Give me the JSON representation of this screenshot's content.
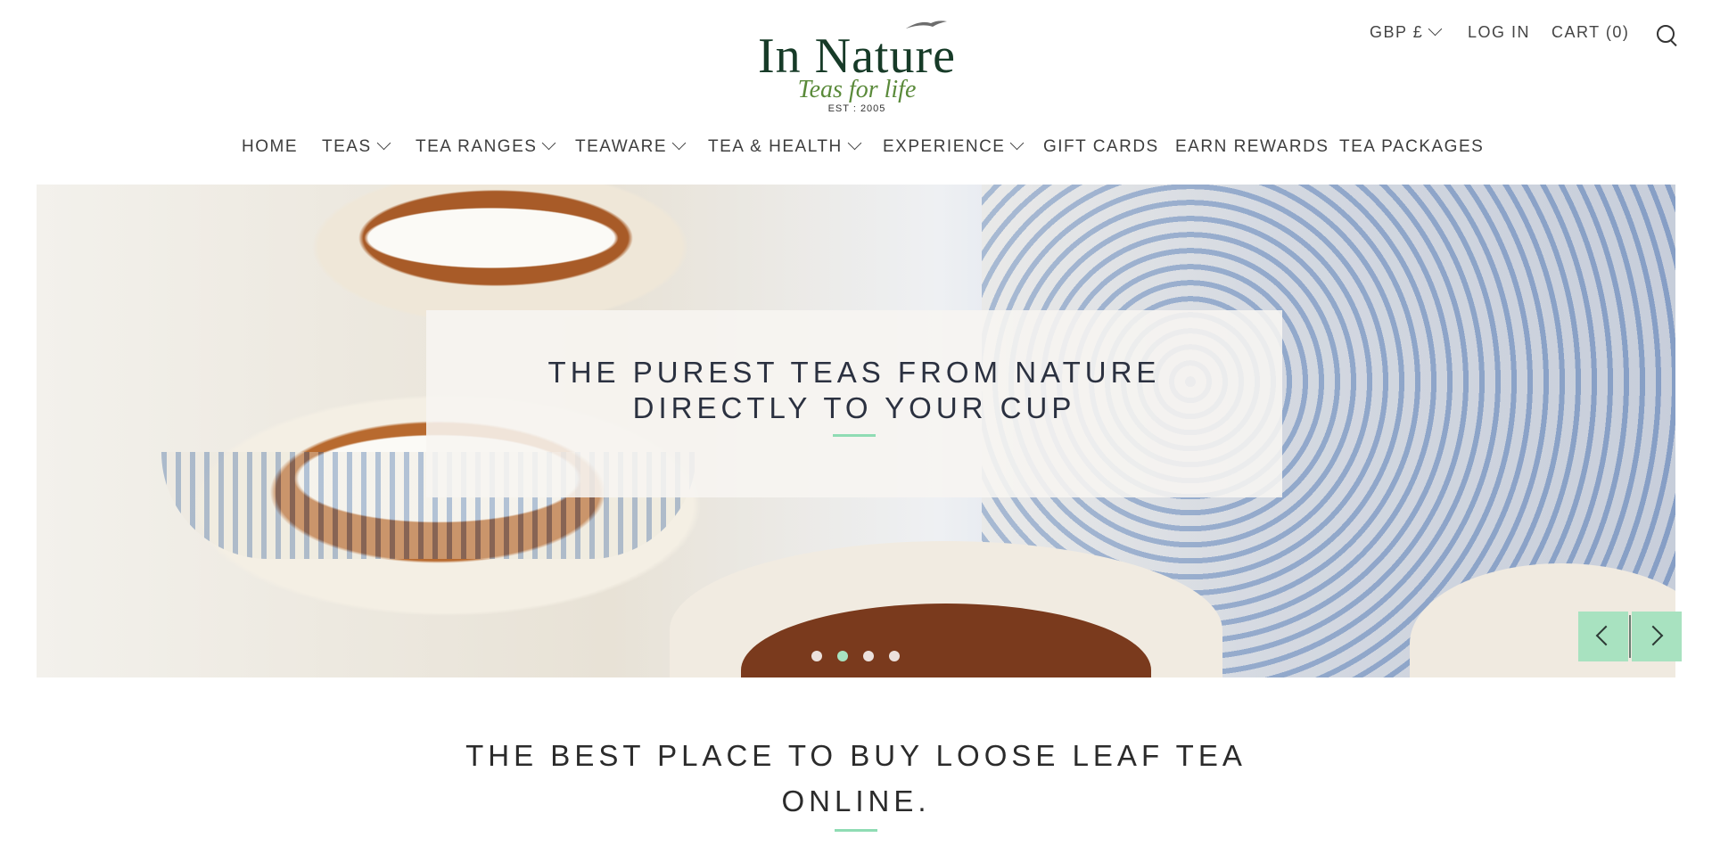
{
  "brand": {
    "name": "In Nature",
    "tagline": "Teas for life",
    "est": "EST : 2005"
  },
  "utility": {
    "currency": "GBP £",
    "login": "LOG IN",
    "cart": "CART (0)",
    "search_icon": "search-icon"
  },
  "nav": {
    "items": [
      {
        "label": "HOME",
        "dropdown": false
      },
      {
        "label": "TEAS",
        "dropdown": true
      },
      {
        "label": "TEA RANGES",
        "dropdown": true
      },
      {
        "label": "TEAWARE",
        "dropdown": true
      },
      {
        "label": "TEA & HEALTH",
        "dropdown": true
      },
      {
        "label": "EXPERIENCE",
        "dropdown": true
      },
      {
        "label": "GIFT CARDS",
        "dropdown": false
      },
      {
        "label": "EARN REWARDS",
        "dropdown": false
      },
      {
        "label": "TEA PACKAGES",
        "dropdown": false
      }
    ]
  },
  "hero": {
    "caption": "THE PUREST TEAS FROM NATURE DIRECTLY TO YOUR CUP",
    "slide_count": 4,
    "active_slide": 2,
    "prev_icon": "chevron-left-icon",
    "next_icon": "chevron-right-icon"
  },
  "section": {
    "title": "THE BEST PLACE TO BUY LOOSE LEAF TEA ONLINE."
  },
  "colors": {
    "accent": "#a8e2c0",
    "brand_green": "#173b28",
    "tagline_green": "#5a8a3a",
    "text": "#2b3140"
  }
}
